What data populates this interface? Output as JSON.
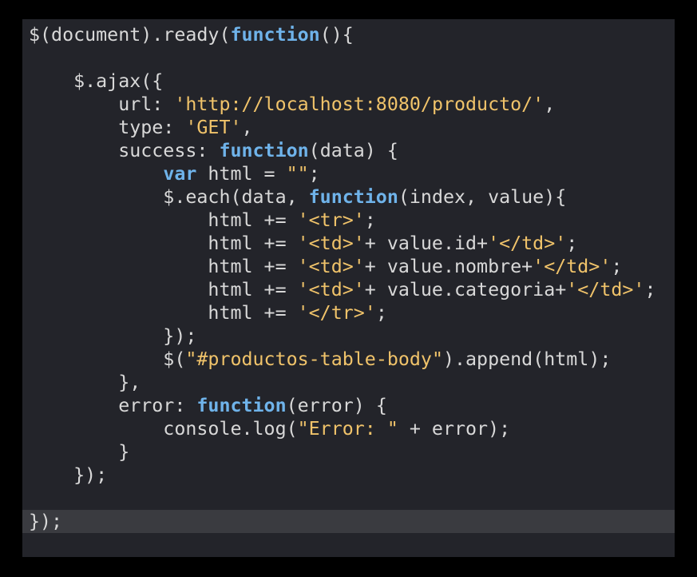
{
  "editor": {
    "colors": {
      "background": "#23242a",
      "current_line": "#3a3b40",
      "plain": "#d8d8d8",
      "keyword": "#6fb3ea",
      "string": "#f0c36a"
    },
    "current_line_index": 22,
    "lines": [
      [
        {
          "t": "p",
          "v": "$(document).ready("
        },
        {
          "t": "k",
          "v": "function"
        },
        {
          "t": "p",
          "v": "(){"
        }
      ],
      [],
      [
        {
          "t": "p",
          "v": "    $.ajax({"
        }
      ],
      [
        {
          "t": "p",
          "v": "        url: "
        },
        {
          "t": "s",
          "v": "'http://localhost:8080/producto/'"
        },
        {
          "t": "p",
          "v": ","
        }
      ],
      [
        {
          "t": "p",
          "v": "        type: "
        },
        {
          "t": "s",
          "v": "'GET'"
        },
        {
          "t": "p",
          "v": ","
        }
      ],
      [
        {
          "t": "p",
          "v": "        success: "
        },
        {
          "t": "k",
          "v": "function"
        },
        {
          "t": "p",
          "v": "(data) {"
        }
      ],
      [
        {
          "t": "p",
          "v": "            "
        },
        {
          "t": "k",
          "v": "var"
        },
        {
          "t": "p",
          "v": " html = "
        },
        {
          "t": "s",
          "v": "\"\""
        },
        {
          "t": "p",
          "v": ";"
        }
      ],
      [
        {
          "t": "p",
          "v": "            $.each(data, "
        },
        {
          "t": "k",
          "v": "function"
        },
        {
          "t": "p",
          "v": "(index, value){"
        }
      ],
      [
        {
          "t": "p",
          "v": "                html += "
        },
        {
          "t": "s",
          "v": "'<tr>'"
        },
        {
          "t": "p",
          "v": ";"
        }
      ],
      [
        {
          "t": "p",
          "v": "                html += "
        },
        {
          "t": "s",
          "v": "'<td>'"
        },
        {
          "t": "p",
          "v": "+ value.id+"
        },
        {
          "t": "s",
          "v": "'</td>'"
        },
        {
          "t": "p",
          "v": ";"
        }
      ],
      [
        {
          "t": "p",
          "v": "                html += "
        },
        {
          "t": "s",
          "v": "'<td>'"
        },
        {
          "t": "p",
          "v": "+ value.nombre+"
        },
        {
          "t": "s",
          "v": "'</td>'"
        },
        {
          "t": "p",
          "v": ";"
        }
      ],
      [
        {
          "t": "p",
          "v": "                html += "
        },
        {
          "t": "s",
          "v": "'<td>'"
        },
        {
          "t": "p",
          "v": "+ value.categoria+"
        },
        {
          "t": "s",
          "v": "'</td>'"
        },
        {
          "t": "p",
          "v": ";"
        }
      ],
      [
        {
          "t": "p",
          "v": "                html += "
        },
        {
          "t": "s",
          "v": "'</tr>'"
        },
        {
          "t": "p",
          "v": ";"
        }
      ],
      [
        {
          "t": "p",
          "v": "            });"
        }
      ],
      [
        {
          "t": "p",
          "v": "            $("
        },
        {
          "t": "s",
          "v": "\"#productos-table-body\""
        },
        {
          "t": "p",
          "v": ").append(html);"
        }
      ],
      [
        {
          "t": "p",
          "v": "        },"
        }
      ],
      [
        {
          "t": "p",
          "v": "        error: "
        },
        {
          "t": "k",
          "v": "function"
        },
        {
          "t": "p",
          "v": "(error) {"
        }
      ],
      [
        {
          "t": "p",
          "v": "            console.log("
        },
        {
          "t": "s",
          "v": "\"Error: \""
        },
        {
          "t": "p",
          "v": " + error);"
        }
      ],
      [
        {
          "t": "p",
          "v": "        }"
        }
      ],
      [
        {
          "t": "p",
          "v": "    });"
        }
      ],
      [],
      [
        {
          "t": "p",
          "v": "});"
        }
      ]
    ]
  }
}
